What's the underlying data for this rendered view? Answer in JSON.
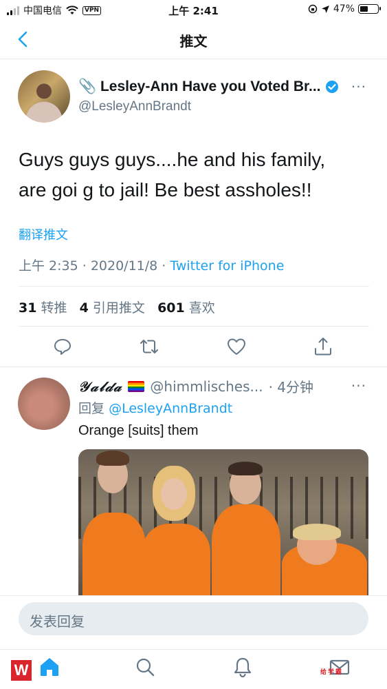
{
  "status_bar": {
    "carrier": "中国电信",
    "vpn": "VPN",
    "time": "上午 2:41",
    "battery": "47%"
  },
  "nav": {
    "title": "推文"
  },
  "tweet": {
    "author_name": "📎 Lesley-Ann Have you Voted Br...",
    "author_handle": "@LesleyAnnBrandt",
    "more": "···",
    "text_line1": "Guys guys guys....he and his family,",
    "text_line2": "are goi g to jail! Be best assholes!!",
    "translate": "翻译推文",
    "time": "上午 2:35 · 2020/11/8 · ",
    "source": "Twitter for iPhone",
    "retweets_count": "31",
    "retweets_label": "转推",
    "quotes_count": "4",
    "quotes_label": "引用推文",
    "likes_count": "601",
    "likes_label": "喜欢"
  },
  "reply": {
    "name": "𝒴𝒶𝓁𝒹𝒶",
    "handle": "@himmlisches...",
    "time": "· 4分钟",
    "more": "···",
    "replying_to_label": "回复",
    "replying_to_handle": "@LesleyAnnBrandt",
    "text": "Orange [suits] them"
  },
  "compose": {
    "placeholder": "发表回复"
  },
  "watermark": {
    "logo": "W",
    "text": "给学霸"
  },
  "colors": {
    "accent": "#1da1f2",
    "secondary_text": "#657786",
    "divider": "#e6ecf0"
  },
  "icons": {
    "back": "chevron-left-icon",
    "verified": "verified-badge-icon",
    "reply": "comment-icon",
    "retweet": "retweet-icon",
    "like": "heart-icon",
    "share": "share-icon",
    "home": "home-icon",
    "search": "search-icon",
    "notifications": "bell-icon",
    "messages": "mail-icon"
  }
}
